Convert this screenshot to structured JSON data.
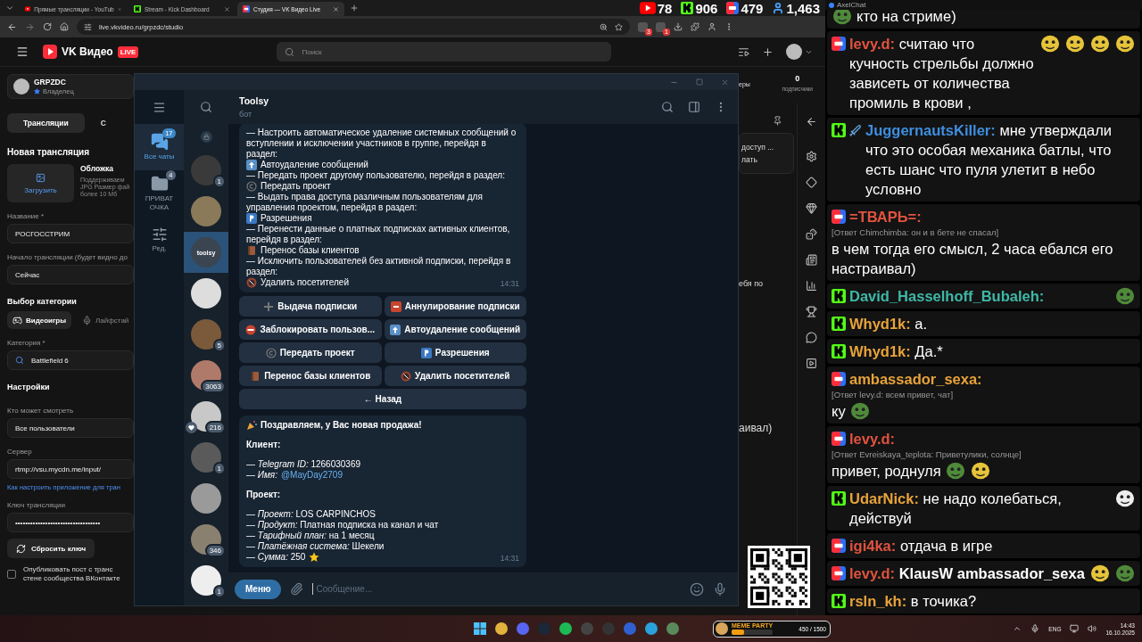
{
  "browser": {
    "tabs": [
      {
        "title": "Прямые трансляции - YouTub",
        "kind": "youtube",
        "selected": false
      },
      {
        "title": "Stream - Kick Dashboard",
        "kind": "kick",
        "selected": false
      },
      {
        "title": "Студия — VK Видео Live",
        "kind": "vk",
        "selected": true
      }
    ],
    "url": "live.vkvideo.ru/grpzdc/studio",
    "extension_badges": [
      "3",
      "1"
    ]
  },
  "stream_overlay": {
    "counters": [
      {
        "kind": "youtube",
        "value": "78"
      },
      {
        "kind": "kick",
        "value": "906"
      },
      {
        "kind": "vk",
        "value": "479"
      },
      {
        "kind": "viewers",
        "value": "1,463"
      }
    ]
  },
  "vk_header": {
    "logo": "VK Видео",
    "badge": "LIVE",
    "search_placeholder": "Поиск"
  },
  "studio": {
    "channel": {
      "name": "GRPZDC",
      "role": "Владелец"
    },
    "tabs": [
      {
        "label": "Трансляции",
        "selected": true
      },
      {
        "label": "С",
        "selected": false
      }
    ],
    "title": "Новая трансляция",
    "cover": {
      "button": "Загрузить",
      "label": "Обложка",
      "hints": [
        "Поддерживаем",
        "JPG Размер фай",
        "более 10 Мб"
      ]
    },
    "form": [
      {
        "kind": "label",
        "text": "Название *"
      },
      {
        "kind": "field",
        "value": "РОСГОССТРИМ"
      },
      {
        "kind": "label",
        "text": "Начало трансляции (будет видно до"
      },
      {
        "kind": "field",
        "value": "Сейчас"
      },
      {
        "kind": "heading",
        "text": "Выбор категории"
      },
      {
        "kind": "chips",
        "items": [
          {
            "label": "Видеоигры",
            "kind": "gamepad",
            "selected": true
          },
          {
            "label": "Лайфстай",
            "kind": "mic",
            "selected": false
          }
        ]
      },
      {
        "kind": "label",
        "text": "Категория *"
      },
      {
        "kind": "search",
        "value": "Battlefield 6"
      },
      {
        "kind": "heading",
        "text": "Настройки"
      },
      {
        "kind": "label",
        "text": "Кто может смотреть"
      },
      {
        "kind": "field",
        "value": "Все пользователи"
      },
      {
        "kind": "label",
        "text": "Сервер"
      },
      {
        "kind": "field",
        "value": "rtmp://vsu.mycdn.me/input/"
      },
      {
        "kind": "link",
        "text": "Как настроить приложение для тран"
      },
      {
        "kind": "label",
        "text": "Ключ трансляции"
      },
      {
        "kind": "field",
        "value": "••••••••••••••••••••••••••••••••••"
      },
      {
        "kind": "button",
        "text": "Сбросить ключ"
      },
      {
        "kind": "checkbox",
        "checked": false,
        "lines": [
          "Опубликовать пост с транс",
          "стене сообщества ВКонтакте"
        ]
      }
    ],
    "stats": {
      "value": "0",
      "label": "подписчики"
    },
    "stats_fragment": "еры",
    "card_fragments": [
      "доступ ...",
      "лать"
    ],
    "fragments": [
      "ебя по",
      "аивал)"
    ]
  },
  "telegram": {
    "folders": [
      {
        "label": "Все чаты",
        "badge": "17",
        "kind": "chats",
        "selected": true
      },
      {
        "label": "ПРИВАТ ОЧКА",
        "badge": "4",
        "kind": "folder",
        "selected": false
      },
      {
        "label": "Ред.",
        "kind": "edit",
        "selected": false
      }
    ],
    "chats": [
      {
        "badge": "1",
        "selected": false
      },
      {
        "selected": false
      },
      {
        "logo": "toolsy",
        "selected": true
      },
      {
        "selected": false
      },
      {
        "badge": "5",
        "selected": false
      },
      {
        "badge": "3063",
        "selected": false
      },
      {
        "badge": "216",
        "heart": true,
        "selected": false
      },
      {
        "badge": "1",
        "selected": false
      },
      {
        "selected": false
      },
      {
        "badge": "346",
        "selected": false
      },
      {
        "badge": "1",
        "selected": false
      }
    ],
    "header": {
      "title": "Toolsy",
      "subtitle": "бот"
    },
    "menu_message": {
      "paragraphs": [
        {
          "text": "— Настроить автоматическое удаление системных сообщений о вступлении и исключении участников в группе, перейдя в раздел:",
          "kind": "up",
          "section": "Автоудаление сообщений"
        },
        {
          "text": "— Передать проект другому пользователю, перейдя в раздел:",
          "kind": "copyright",
          "section": "Передать проект"
        },
        {
          "text": "— Выдать права доступа различным пользователям для управления проектом, перейдя в раздел:",
          "kind": "p",
          "section": "Разрешения"
        },
        {
          "text": "— Перенести данные о платных подписках активных клиентов, перейдя в раздел:",
          "kind": "book",
          "section": "Перенос базы клиентов"
        },
        {
          "text": "— Исключить пользователей без активной подписки, перейдя в раздел:",
          "kind": "walker",
          "section": "Удалить посетителей"
        }
      ],
      "time": "14:31",
      "buttons": [
        {
          "label": "Выдача подписки",
          "kind": "plus"
        },
        {
          "label": "Аннулирование подписки",
          "kind": "cl"
        },
        {
          "label": "Заблокировать пользов...",
          "kind": "noentry"
        },
        {
          "label": "Автоудаление сообщений",
          "kind": "up"
        },
        {
          "label": "Передать проект",
          "kind": "copyright"
        },
        {
          "label": "Разрешения",
          "kind": "p"
        },
        {
          "label": "Перенос базы клиентов",
          "kind": "book"
        },
        {
          "label": "Удалить посетителей",
          "kind": "walker"
        }
      ],
      "back": "← Назад"
    },
    "sale_message": {
      "lines": [
        {
          "kind": "title",
          "text": "Поздравляем, у Вас новая продажа!"
        },
        {
          "kind": "heading",
          "text": "Клиент:"
        },
        {
          "kind": "field",
          "text": "— *Telegram ID:* 1266030369"
        },
        {
          "kind": "field",
          "text": "— *Имя:*",
          "link": "@MayDay2709"
        },
        {
          "kind": "heading",
          "text": "Проект:"
        },
        {
          "kind": "field",
          "text": "— *Проект:* LOS CARPINCHOS"
        },
        {
          "kind": "field",
          "text": "— *Продукт:* Платная подписка на канал и чат"
        },
        {
          "kind": "field",
          "text": "— *Тарифный план:* на 1 месяц"
        },
        {
          "kind": "field",
          "text": "— *Платёжная система:* Шекели"
        },
        {
          "kind": "amount",
          "text": "— *Сумма:* 250"
        }
      ],
      "time": "14:31"
    },
    "input": {
      "menu": "Меню",
      "placeholder": "Сообщение..."
    }
  },
  "chat": {
    "title": "AxelChat",
    "messages": [
      {
        "kind": "continuation",
        "text": "кто на стриме)",
        "emotes": [
          {
            "kind": "pepe"
          }
        ]
      },
      {
        "kind": "vk",
        "author": "levy.d:",
        "color": "#e0533f",
        "text": "считаю что кучность стрельбы должно зависеть от количества промиль в крови ,",
        "emotes": [
          {
            "kind": "smile"
          },
          {
            "kind": "smile"
          },
          {
            "kind": "smile"
          },
          {
            "kind": "smile"
          }
        ]
      },
      {
        "kind": "kick",
        "badge": true,
        "author": "JuggernautsKiller:",
        "color": "#3d8fe0",
        "text": "мне утверждали что это особая механика батлы, что есть шанс что пуля улетит в небо условно"
      },
      {
        "kind": "vk",
        "author": "=ТВАРЬ=:",
        "color": "#e0533f",
        "reply": "[Ответ Chimchimba: он и в бете не спасал]",
        "text": "в чем тогда его смысл, 2 часа ебался его настраивал)"
      },
      {
        "kind": "kick",
        "author": "David_Hasselhoff_Bubaleh:",
        "color": "#3fb8a8",
        "emotes": [
          {
            "kind": "pepe"
          }
        ]
      },
      {
        "kind": "kick",
        "author": "Whyd1k:",
        "color": "#e8a33a",
        "text": "а."
      },
      {
        "kind": "kick",
        "author": "Whyd1k:",
        "color": "#e8a33a",
        "text": "Да.*"
      },
      {
        "kind": "vk",
        "author": "ambassador_sexa:",
        "color": "#e8a33a",
        "reply": "[Ответ levy.d: всем привет, чат]",
        "text": "ку",
        "emotes": [
          {
            "kind": "pepe"
          }
        ]
      },
      {
        "kind": "vk",
        "author": "levy.d:",
        "color": "#e0533f",
        "reply": "[Ответ Evreiskaya_teplota: Приветулики, солнце]",
        "text": "привет, роднуля",
        "emotes": [
          {
            "kind": "pepe"
          },
          {
            "kind": "smile"
          }
        ]
      },
      {
        "kind": "kick",
        "author": "UdarNick:",
        "color": "#e8a33a",
        "text": "не надо колебаться, действуй",
        "emotes": [
          {
            "kind": "joker"
          }
        ]
      },
      {
        "kind": "vk",
        "author": "igi4ka:",
        "color": "#e0533f",
        "text": "отдача в игре"
      },
      {
        "kind": "vk",
        "author": "levy.d:",
        "color": "#e0533f",
        "text": "KlausW ambassador_sexa",
        "bold": true,
        "emotes": [
          {
            "kind": "smile"
          },
          {
            "kind": "pepe"
          }
        ]
      },
      {
        "kind": "kick",
        "author": "rsln_kh:",
        "color": "#e8a33a",
        "text": "в точика?"
      }
    ]
  },
  "taskbar": {
    "widget": {
      "title": "MEME PARTY",
      "progress": "450 / 1500",
      "level": 0.3
    },
    "tray": {
      "language": "ENG",
      "time": "14:43",
      "date": "16.10.2025"
    }
  }
}
